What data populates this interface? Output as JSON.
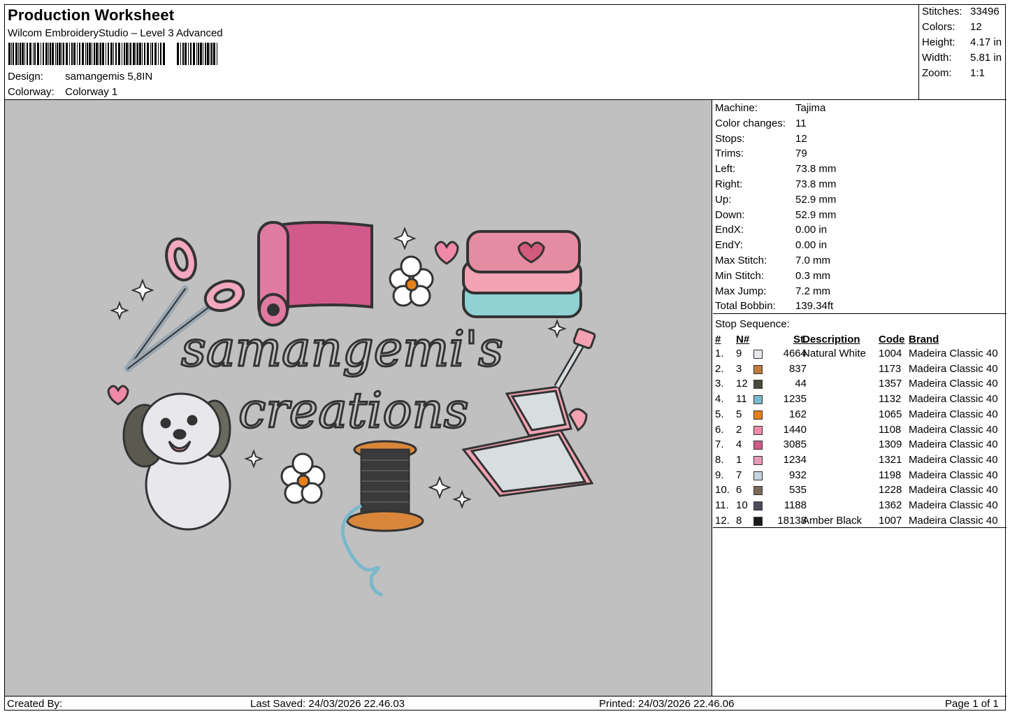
{
  "header": {
    "title": "Production Worksheet",
    "software": "Wilcom EmbroideryStudio – Level 3 Advanced",
    "design_label": "Design:",
    "design_value": "samangemis 5,8IN",
    "colorway_label": "Colorway:",
    "colorway_value": "Colorway 1"
  },
  "summary": {
    "stitches_label": "Stitches:",
    "stitches_value": "33496",
    "colors_label": "Colors:",
    "colors_value": "12",
    "height_label": "Height:",
    "height_value": "4.17 in",
    "width_label": "Width:",
    "width_value": "5.81 in",
    "zoom_label": "Zoom:",
    "zoom_value": "1:1"
  },
  "design": {
    "line1": "samangemi's",
    "line2": "creations"
  },
  "properties": [
    {
      "label": "Machine:",
      "value": "Tajima"
    },
    {
      "label": "Color changes:",
      "value": "11"
    },
    {
      "label": "Stops:",
      "value": "12"
    },
    {
      "label": "Trims:",
      "value": "79"
    },
    {
      "label": "Left:",
      "value": "73.8 mm"
    },
    {
      "label": "Right:",
      "value": "73.8 mm"
    },
    {
      "label": "Up:",
      "value": "52.9 mm"
    },
    {
      "label": "Down:",
      "value": "52.9 mm"
    },
    {
      "label": "EndX:",
      "value": "0.00 in"
    },
    {
      "label": "EndY:",
      "value": "0.00 in"
    },
    {
      "label": "Max Stitch:",
      "value": "7.0 mm"
    },
    {
      "label": "Min Stitch:",
      "value": "0.3 mm"
    },
    {
      "label": "Max Jump:",
      "value": "7.2 mm"
    },
    {
      "label": "Total Bobbin:",
      "value": "139.34ft"
    }
  ],
  "stop_sequence": {
    "title": "Stop Sequence:",
    "columns": {
      "num": "#",
      "n": "N#",
      "st": "St.",
      "description": "Description",
      "code": "Code",
      "brand": "Brand"
    },
    "rows": [
      {
        "idx": "1.",
        "n": "9",
        "color": "#e8e8ec",
        "st": "4664",
        "description": "Natural White",
        "code": "1004",
        "brand": "Madeira Classic 40"
      },
      {
        "idx": "2.",
        "n": "3",
        "color": "#c07a3a",
        "st": "837",
        "description": "",
        "code": "1173",
        "brand": "Madeira Classic 40"
      },
      {
        "idx": "3.",
        "n": "12",
        "color": "#4a4a3a",
        "st": "44",
        "description": "",
        "code": "1357",
        "brand": "Madeira Classic 40"
      },
      {
        "idx": "4.",
        "n": "11",
        "color": "#7ab8cc",
        "st": "1235",
        "description": "",
        "code": "1132",
        "brand": "Madeira Classic 40"
      },
      {
        "idx": "5.",
        "n": "5",
        "color": "#e8801a",
        "st": "162",
        "description": "",
        "code": "1065",
        "brand": "Madeira Classic 40"
      },
      {
        "idx": "6.",
        "n": "2",
        "color": "#f08aa8",
        "st": "1440",
        "description": "",
        "code": "1108",
        "brand": "Madeira Classic 40"
      },
      {
        "idx": "7.",
        "n": "4",
        "color": "#d05a8a",
        "st": "3085",
        "description": "",
        "code": "1309",
        "brand": "Madeira Classic 40"
      },
      {
        "idx": "8.",
        "n": "1",
        "color": "#e89ab8",
        "st": "1234",
        "description": "",
        "code": "1321",
        "brand": "Madeira Classic 40"
      },
      {
        "idx": "9.",
        "n": "7",
        "color": "#c8d2e0",
        "st": "932",
        "description": "",
        "code": "1198",
        "brand": "Madeira Classic 40"
      },
      {
        "idx": "10.",
        "n": "6",
        "color": "#7a6a5a",
        "st": "535",
        "description": "",
        "code": "1228",
        "brand": "Madeira Classic 40"
      },
      {
        "idx": "11.",
        "n": "10",
        "color": "#4a4a5a",
        "st": "1188",
        "description": "",
        "code": "1362",
        "brand": "Madeira Classic 40"
      },
      {
        "idx": "12.",
        "n": "8",
        "color": "#1a1a1a",
        "st": "18138",
        "description": "Amber Black",
        "code": "1007",
        "brand": "Madeira Classic 40"
      }
    ]
  },
  "footer": {
    "created_by": "Created By:",
    "last_saved": "Last Saved: 24/03/2026 22.46.03",
    "printed": "Printed: 24/03/2026 22.46.06",
    "page": "Page 1 of 1"
  }
}
